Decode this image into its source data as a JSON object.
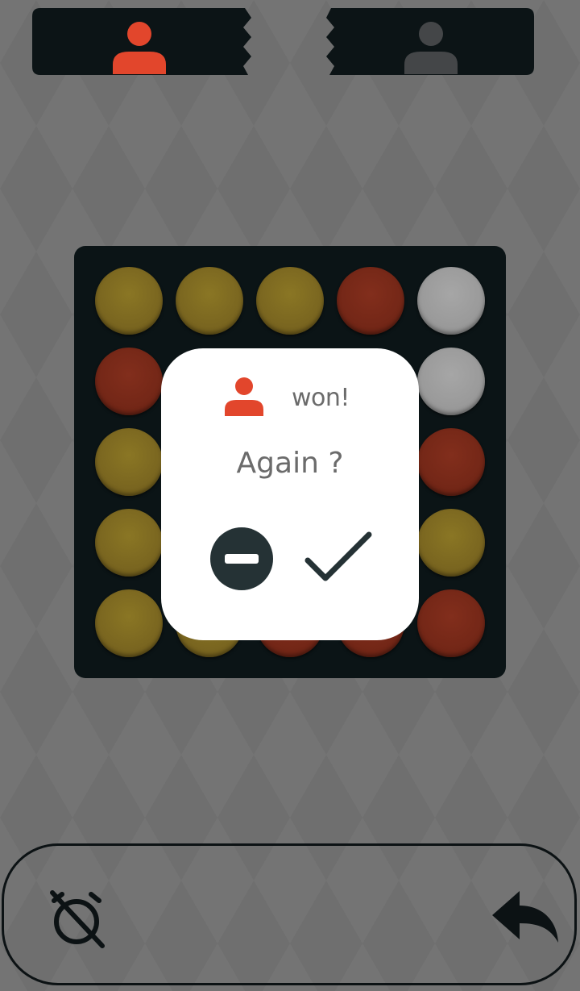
{
  "players": [
    {
      "id": "player-1",
      "color": "#e2462c",
      "active": true
    },
    {
      "id": "player-2",
      "color": "#444648",
      "active": false
    }
  ],
  "board": {
    "rows": 5,
    "cols": 5,
    "cells": [
      [
        "yellow",
        "yellow",
        "yellow",
        "red",
        "empty"
      ],
      [
        "red",
        "hidden",
        "hidden",
        "hidden",
        "empty"
      ],
      [
        "yellow",
        "hidden",
        "hidden",
        "hidden",
        "red"
      ],
      [
        "yellow",
        "hidden",
        "hidden",
        "hidden",
        "yellow"
      ],
      [
        "yellow",
        "yellow",
        "red",
        "red",
        "red"
      ]
    ]
  },
  "dialog": {
    "winner_color": "#e2462c",
    "won_label": "won!",
    "question": "Again ?",
    "decline_icon": "minus-circle-icon",
    "accept_icon": "checkmark-icon"
  },
  "toolbar": {
    "timer_icon": "timer-off-icon",
    "undo_icon": "undo-icon"
  },
  "colors": {
    "background": "#6f6f6f",
    "dark": "#0b1416",
    "accent": "#e2462c"
  }
}
